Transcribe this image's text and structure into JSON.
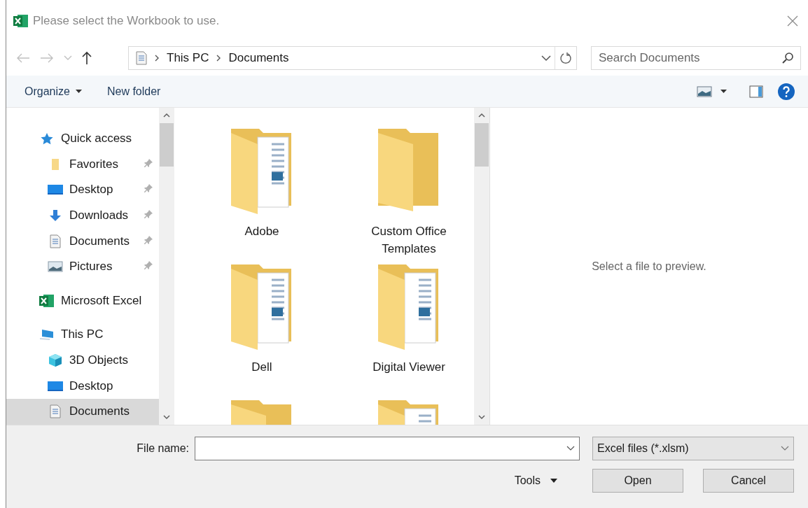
{
  "window": {
    "title": "Please select the Workbook to use."
  },
  "address_bar": {
    "path": [
      "This PC",
      "Documents"
    ]
  },
  "search": {
    "placeholder": "Search Documents"
  },
  "toolbar": {
    "buttons": [
      "Organize",
      "New folder"
    ]
  },
  "nav": [
    {
      "label": "Quick access",
      "kind": "star",
      "selected": false,
      "children": [
        {
          "label": "Favorites",
          "kind": "folder",
          "pinned": true,
          "selected": false
        },
        {
          "label": "Desktop",
          "kind": "desktop",
          "pinned": true,
          "selected": false
        },
        {
          "label": "Downloads",
          "kind": "download",
          "pinned": true,
          "selected": false
        },
        {
          "label": "Documents",
          "kind": "document",
          "pinned": true,
          "selected": false
        },
        {
          "label": "Pictures",
          "kind": "pictures",
          "pinned": true,
          "selected": false
        }
      ]
    },
    {
      "label": "Microsoft Excel",
      "kind": "excel",
      "selected": false
    },
    {
      "label": "This PC",
      "kind": "pc",
      "selected": false,
      "children": [
        {
          "label": "3D Objects",
          "kind": "cube",
          "selected": false
        },
        {
          "label": "Desktop",
          "kind": "desktop",
          "selected": false
        },
        {
          "label": "Documents",
          "kind": "document",
          "selected": true
        }
      ]
    }
  ],
  "files": [
    {
      "name": "Adobe",
      "kind": "folder-docs"
    },
    {
      "name": "Custom Office Templates",
      "kind": "folder"
    },
    {
      "name": "Dell",
      "kind": "folder-docs"
    },
    {
      "name": "Digital Viewer",
      "kind": "folder-docs"
    },
    {
      "kind": "folder"
    },
    {
      "kind": "folder-docs"
    }
  ],
  "preview": {
    "message": "Select a file to preview."
  },
  "file_name": {
    "label": "File name:"
  },
  "file_type": {
    "value": "Excel files (*.xlsm)"
  },
  "tools": {
    "label": "Tools"
  },
  "buttons": [
    "Open",
    "Cancel"
  ]
}
